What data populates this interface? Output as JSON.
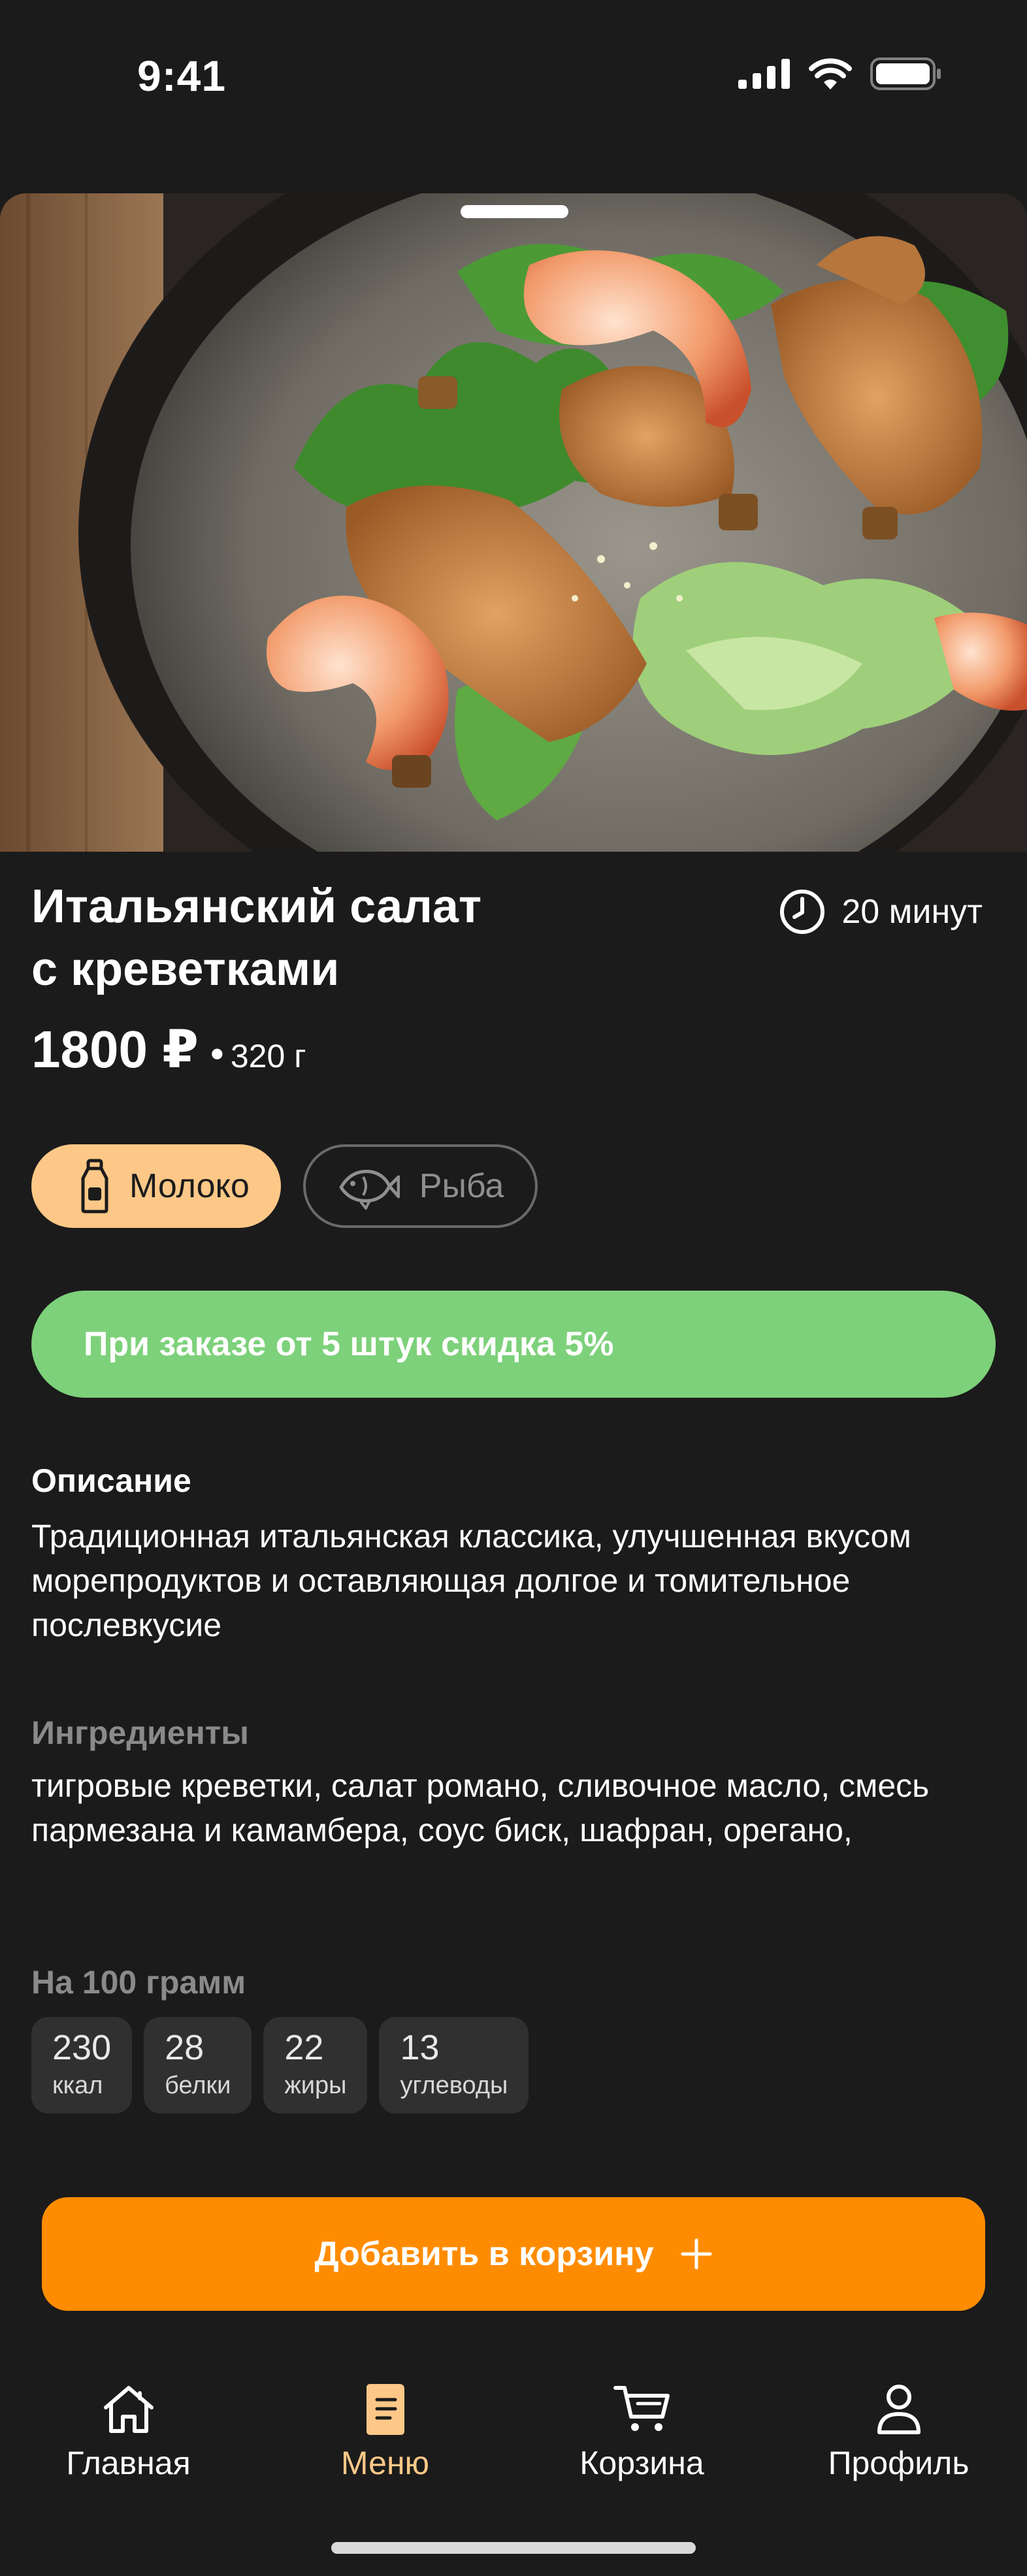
{
  "status": {
    "time": "9:41"
  },
  "dish": {
    "title_line1": "Итальянский салат",
    "title_line2": "с креветками",
    "cook_time": "20 минут",
    "price": "1800 ₽",
    "separator": "•",
    "weight": "320 г"
  },
  "allergens": [
    {
      "label": "Молоко",
      "active": true,
      "icon": "milk-bottle-icon"
    },
    {
      "label": "Рыба",
      "active": false,
      "icon": "fish-icon"
    }
  ],
  "promo": {
    "text": "При заказе от 5 штук скидка 5%"
  },
  "description": {
    "heading": "Описание",
    "text": "Традиционная итальянская классика, улучшенная вкусом морепродуктов и оставляющая долгое и томительное послевкусие"
  },
  "ingredients": {
    "heading": "Ингредиенты",
    "text": "тигровые креветки, салат романо, сливочное масло, смесь пармезана и камамбера, соус биск, шафран, орегано,"
  },
  "nutrition": {
    "heading": "На 100 грамм",
    "items": [
      {
        "value": "230",
        "label": "ккал"
      },
      {
        "value": "28",
        "label": "белки"
      },
      {
        "value": "22",
        "label": "жиры"
      },
      {
        "value": "13",
        "label": "углеводы"
      }
    ]
  },
  "cart_button": {
    "label": "Добавить в корзину",
    "icon": "plus-icon"
  },
  "tabbar": {
    "items": [
      {
        "label": "Главная",
        "icon": "home-icon",
        "active": false
      },
      {
        "label": "Меню",
        "icon": "menu-book-icon",
        "active": true
      },
      {
        "label": "Корзина",
        "icon": "cart-icon",
        "active": false
      },
      {
        "label": "Профиль",
        "icon": "profile-icon",
        "active": false
      }
    ]
  },
  "colors": {
    "background": "#1b1b1b",
    "accent_orange": "#ff8c00",
    "chip_active": "#fdc887",
    "promo_green": "#7dd17a",
    "nutrition_box": "#303030"
  }
}
